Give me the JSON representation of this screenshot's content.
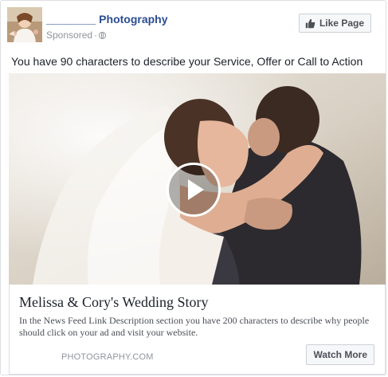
{
  "header": {
    "page_name": "________ Photography",
    "sponsored": "Sponsored",
    "separator": "·",
    "like_label": "Like Page"
  },
  "post": {
    "text": "You have 90 characters to describe your Service, Offer or Call to Action"
  },
  "media": {
    "type": "video",
    "play_icon": "play-icon"
  },
  "link": {
    "title": "Melissa & Cory's Wedding Story",
    "description": "In the News Feed Link Description section you have 200 characters to describe why people should click on your ad and visit your website.",
    "domain": "PHOTOGRAPHY.COM",
    "cta_label": "Watch More"
  },
  "colors": {
    "page_name": "#2c4d90",
    "meta_gray": "#90949c",
    "body_text": "#1d2129",
    "button_bg": "#f6f7f9",
    "border": "#dddfe2"
  }
}
